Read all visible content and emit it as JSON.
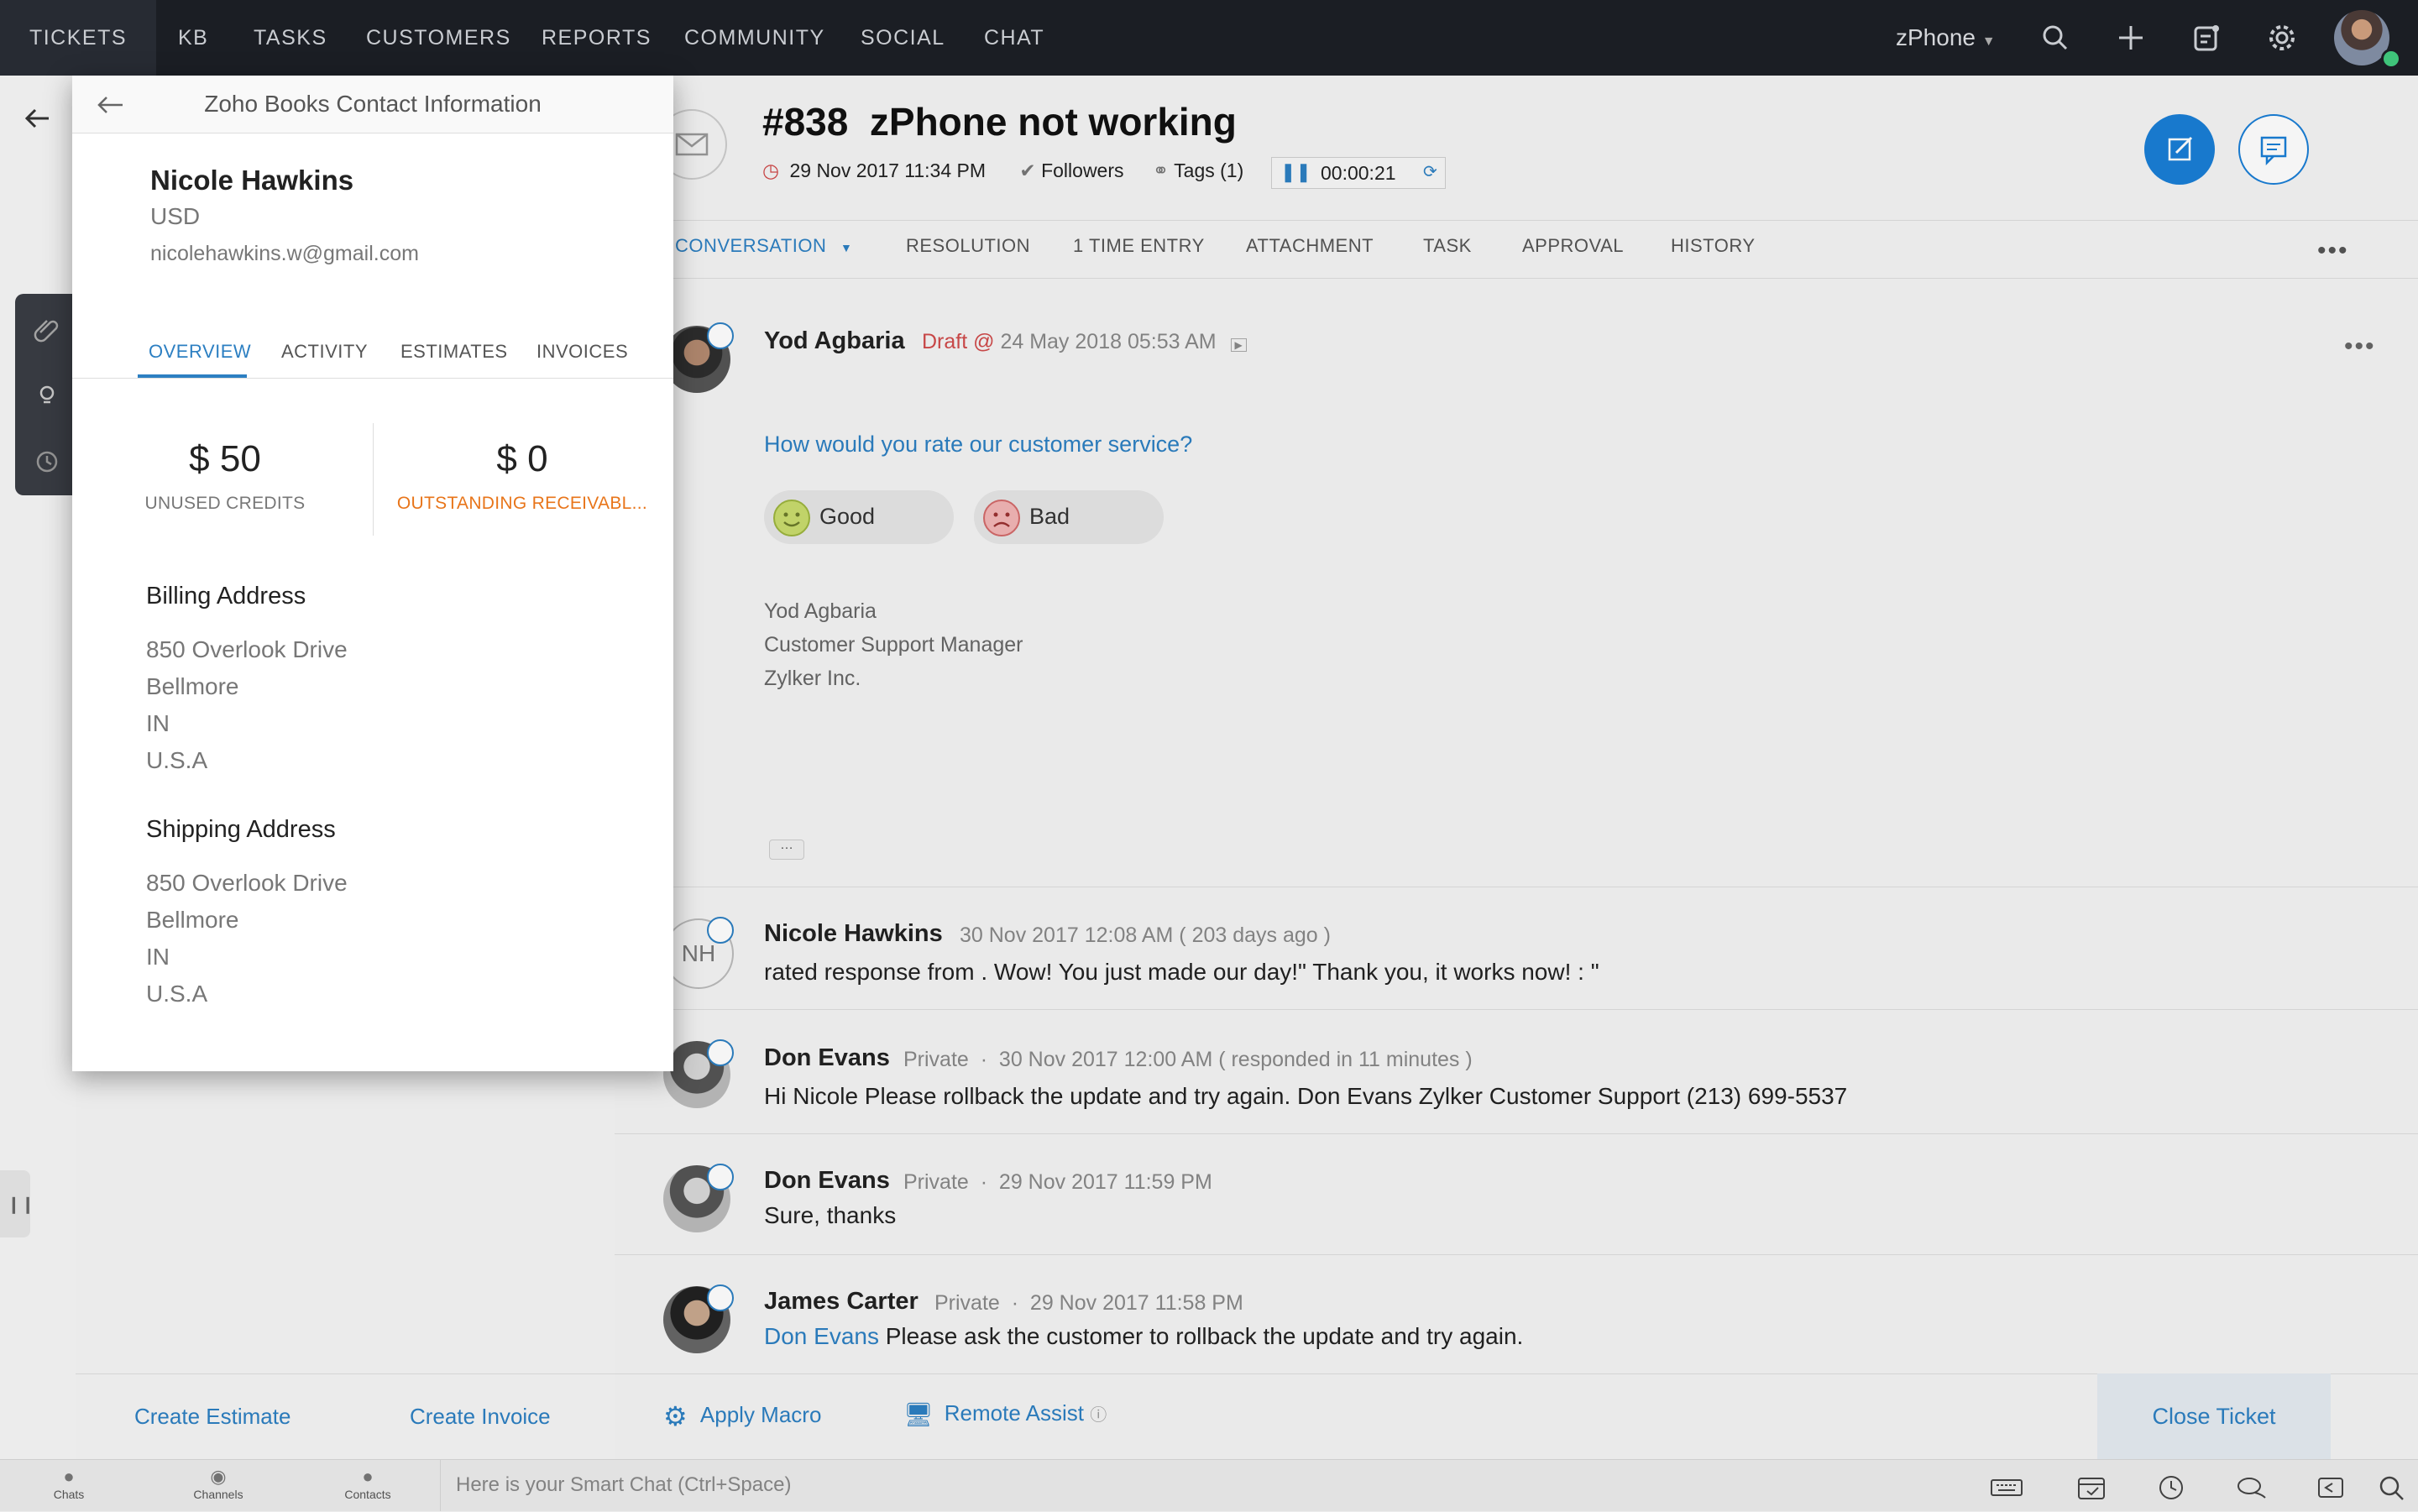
{
  "nav": {
    "items": [
      {
        "id": "tickets",
        "label": "TICKETS"
      },
      {
        "id": "kb",
        "label": "KB"
      },
      {
        "id": "tasks",
        "label": "TASKS"
      },
      {
        "id": "customers",
        "label": "CUSTOMERS"
      },
      {
        "id": "reports",
        "label": "REPORTS"
      },
      {
        "id": "community",
        "label": "COMMUNITY"
      },
      {
        "id": "social",
        "label": "SOCIAL"
      },
      {
        "id": "chat",
        "label": "CHAT"
      }
    ],
    "brand": "zPhone",
    "icons": [
      "search-icon",
      "plus-icon",
      "activity-icon",
      "gear-icon",
      "avatar"
    ]
  },
  "ticket": {
    "number": "#838",
    "subject": "zPhone not working",
    "due": "29 Nov 2017 11:34 PM",
    "followers": "Followers",
    "tags": "Tags (1)",
    "timer": "00:00:21",
    "tabs": [
      "CONVERSATION",
      "RESOLUTION",
      "1 TIME ENTRY",
      "ATTACHMENT",
      "TASK",
      "APPROVAL",
      "HISTORY"
    ]
  },
  "draft": {
    "author": "Yod Agbaria",
    "status": "Draft @",
    "time": "24 May 2018 05:53 AM",
    "question": "How would you rate our customer service?",
    "good": "Good",
    "bad": "Bad",
    "signature": [
      "Yod Agbaria",
      "Customer Support Manager",
      "Zylker Inc."
    ]
  },
  "thread": [
    {
      "author": "Nicole Hawkins",
      "initials": "NH",
      "meta": "30 Nov 2017 12:08 AM ( 203 days ago )",
      "text": "rated response from . Wow! You just made our day!\" Thank you, it works now! : \""
    },
    {
      "author": "Don Evans",
      "visibility": "Private",
      "meta": "30 Nov 2017 12:00 AM ( responded in 11 minutes )",
      "text": "Hi Nicole Please rollback the update and try again. Don Evans Zylker Customer Support (213) 699-5537"
    },
    {
      "author": "Don Evans",
      "visibility": "Private",
      "meta": "29 Nov 2017 11:59 PM",
      "text": "Sure, thanks"
    },
    {
      "author": "James Carter",
      "visibility": "Private",
      "meta": "29 Nov 2017 11:58 PM",
      "mention": "Don Evans",
      "text": "Please ask the customer to rollback the update and try again."
    }
  ],
  "actions": {
    "apply_macro": "Apply Macro",
    "remote_assist": "Remote Assist",
    "close_ticket": "Close Ticket",
    "create_estimate": "Create Estimate",
    "create_invoice": "Create Invoice"
  },
  "bottombar": {
    "chats": "Chats",
    "channels": "Channels",
    "contacts": "Contacts",
    "smartchat_placeholder": "Here is your Smart Chat (Ctrl+Space)"
  },
  "modal": {
    "title": "Zoho Books Contact Information",
    "contact": {
      "name": "Nicole Hawkins",
      "currency": "USD",
      "email": "nicolehawkins.w@gmail.com"
    },
    "tabs": [
      "OVERVIEW",
      "ACTIVITY",
      "ESTIMATES",
      "INVOICES"
    ],
    "unused_credits": {
      "amount": "$ 50",
      "label": "UNUSED CREDITS"
    },
    "outstanding": {
      "amount": "$ 0",
      "label": "OUTSTANDING RECEIVABL..."
    },
    "billing": {
      "heading": "Billing Address",
      "lines": [
        "850 Overlook Drive",
        "Bellmore",
        "IN",
        "U.S.A"
      ]
    },
    "shipping": {
      "heading": "Shipping Address",
      "lines": [
        "850 Overlook Drive",
        "Bellmore",
        "IN",
        "U.S.A"
      ]
    }
  },
  "colors": {
    "accent": "#2c7fc2",
    "topbar": "#1b1e24",
    "draft": "#d04a4a",
    "outstanding": "#e8751a"
  }
}
